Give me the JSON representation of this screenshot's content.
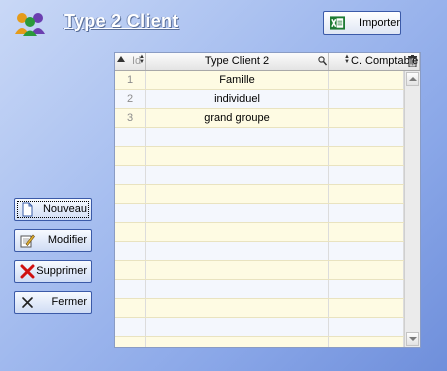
{
  "window": {
    "title": "Type 2 Client"
  },
  "toolbar": {
    "import_label": "Importer"
  },
  "grid": {
    "columns": {
      "id": "Id",
      "type": "Type Client 2",
      "comptable": "C. Comptable"
    },
    "rows": [
      {
        "id": "1",
        "type": "Famille",
        "comptable": ""
      },
      {
        "id": "2",
        "type": "individuel",
        "comptable": ""
      },
      {
        "id": "3",
        "type": "grand groupe",
        "comptable": ""
      }
    ]
  },
  "actions": {
    "nouveau": "Nouveau",
    "modifier": "Modifier",
    "supprimer": "Supprimer",
    "fermer": "Fermer"
  },
  "icons": {
    "title": "users-group-icon",
    "import": "excel-icon",
    "search": "search-icon",
    "delete_column": "trash-icon",
    "nouveau": "new-document-icon",
    "modifier": "edit-icon",
    "supprimer": "delete-x-icon",
    "fermer": "close-x-icon"
  },
  "colors": {
    "accent": "#3b5aa8",
    "row_odd": "#fefbe3",
    "row_even": "#f4f7fd",
    "delete": "#d01010"
  }
}
